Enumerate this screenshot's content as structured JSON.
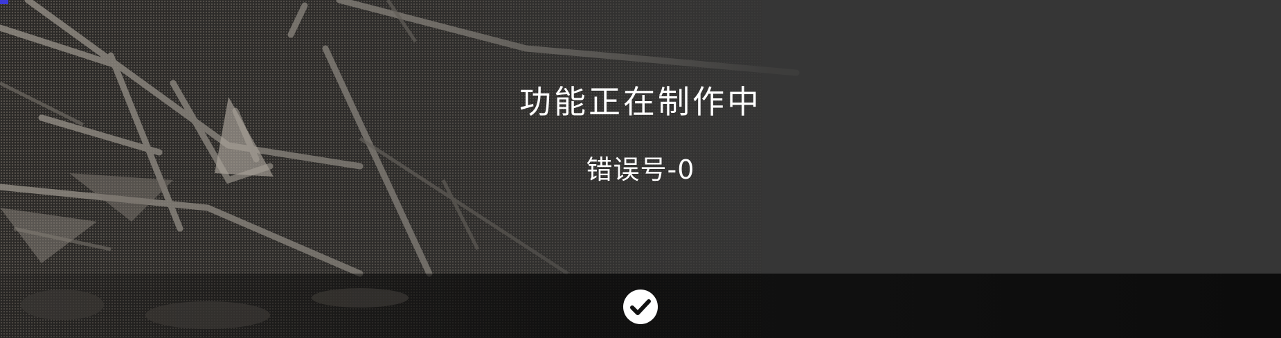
{
  "dialog": {
    "title": "功能正在制作中",
    "subtitle": "错误号-0"
  },
  "actions": {
    "confirm_icon": "checkmark-icon"
  },
  "colors": {
    "panel_background": "#363636",
    "footer_background": "#0e0e0e",
    "text": "#ffffff",
    "accent": "#3c3ad8"
  }
}
